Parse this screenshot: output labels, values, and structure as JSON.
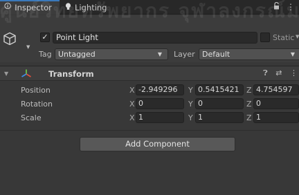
{
  "watermark": "ศูนย์วิทยทรัพยากร จุฬาลงกรณ์มหาวิทยาลัย",
  "tabs": [
    {
      "label": "Inspector",
      "icon": "info-icon",
      "active": true
    },
    {
      "label": "Lighting",
      "icon": "lightbulb-icon",
      "active": false
    }
  ],
  "tabbar_icons": [
    "lock-icon",
    "kebab-menu-icon"
  ],
  "object": {
    "name": "Point Light",
    "active": true,
    "static_label": "Static",
    "tag_label": "Tag",
    "tag_value": "Untagged",
    "layer_label": "Layer",
    "layer_value": "Default"
  },
  "transform": {
    "title": "Transform",
    "rows": [
      {
        "label": "Position",
        "x": "-2.949296",
        "y": "0.5415421",
        "z": "4.754597"
      },
      {
        "label": "Rotation",
        "x": "0",
        "y": "0",
        "z": "0"
      },
      {
        "label": "Scale",
        "x": "1",
        "y": "1",
        "z": "1"
      }
    ],
    "axis_labels": {
      "x": "X",
      "y": "Y",
      "z": "Z"
    }
  },
  "add_component": "Add Component",
  "colors": {
    "accent": "#3a79bb",
    "panel": "#383838",
    "field": "#2a2a2a",
    "header": "#3c3c3c"
  }
}
